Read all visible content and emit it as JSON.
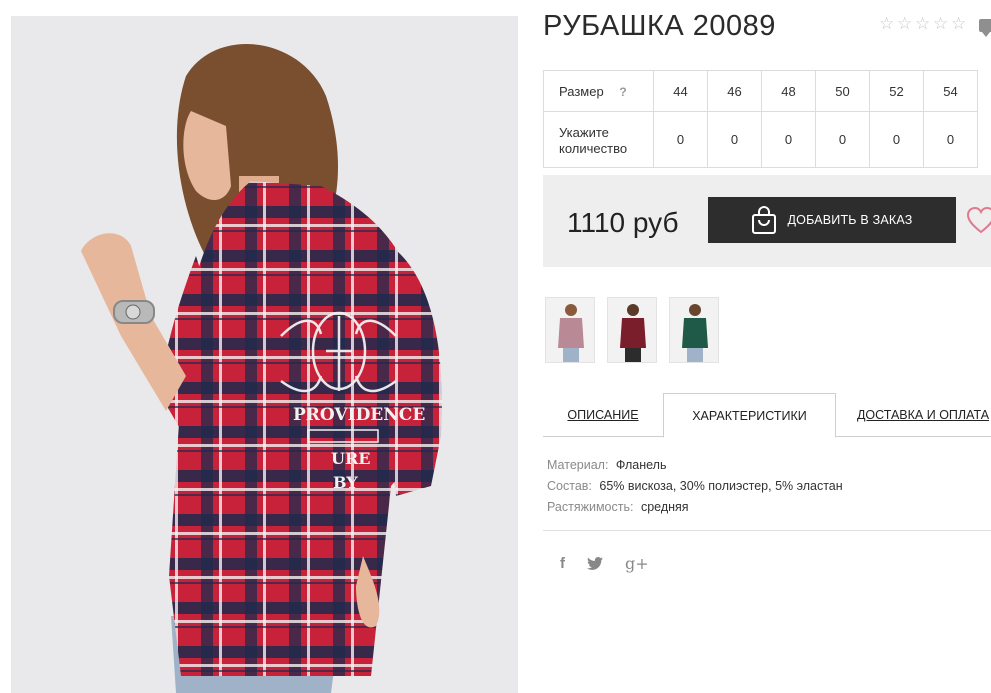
{
  "product": {
    "title": "РУБАШКА 20089",
    "rating_stars": 5,
    "rating_value": 0
  },
  "size_table": {
    "size_label": "Размер",
    "help_mark": "?",
    "sizes": [
      "44",
      "46",
      "48",
      "50",
      "52",
      "54"
    ],
    "qty_label_line1": "Укажите",
    "qty_label_line2": "количество",
    "quantities": [
      "0",
      "0",
      "0",
      "0",
      "0",
      "0"
    ]
  },
  "purchase": {
    "price": "1110 руб",
    "add_button_label": "ДОБАВИТЬ В ЗАКАЗ"
  },
  "thumbnails": [
    {
      "color": "#b98a96",
      "name": "thumb-pink"
    },
    {
      "color": "#7a1e2b",
      "name": "thumb-red"
    },
    {
      "color": "#1f5a48",
      "name": "thumb-green"
    }
  ],
  "tabs": [
    {
      "label": "ОПИСАНИЕ",
      "active": false
    },
    {
      "label": "ХАРАКТЕРИСТИКИ",
      "active": true
    },
    {
      "label": "ДОСТАВКА И ОПЛАТА",
      "active": false
    }
  ],
  "characteristics": [
    {
      "key": "Материал:",
      "value": "Фланель"
    },
    {
      "key": "Состав:",
      "value": "65% вискоза, 30% полиэстер, 5% эластан"
    },
    {
      "key": "Растяжимость:",
      "value": "средняя"
    }
  ],
  "social": {
    "icons": [
      "facebook-icon",
      "twitter-icon",
      "google-plus-icon"
    ],
    "facebook_glyph": "f",
    "google_glyph": "g+"
  },
  "colors": {
    "button_bg": "#2d2d2d",
    "heart": "#e07a8f",
    "shirt_red": "#c8213a",
    "shirt_navy": "#1f2a4d"
  }
}
